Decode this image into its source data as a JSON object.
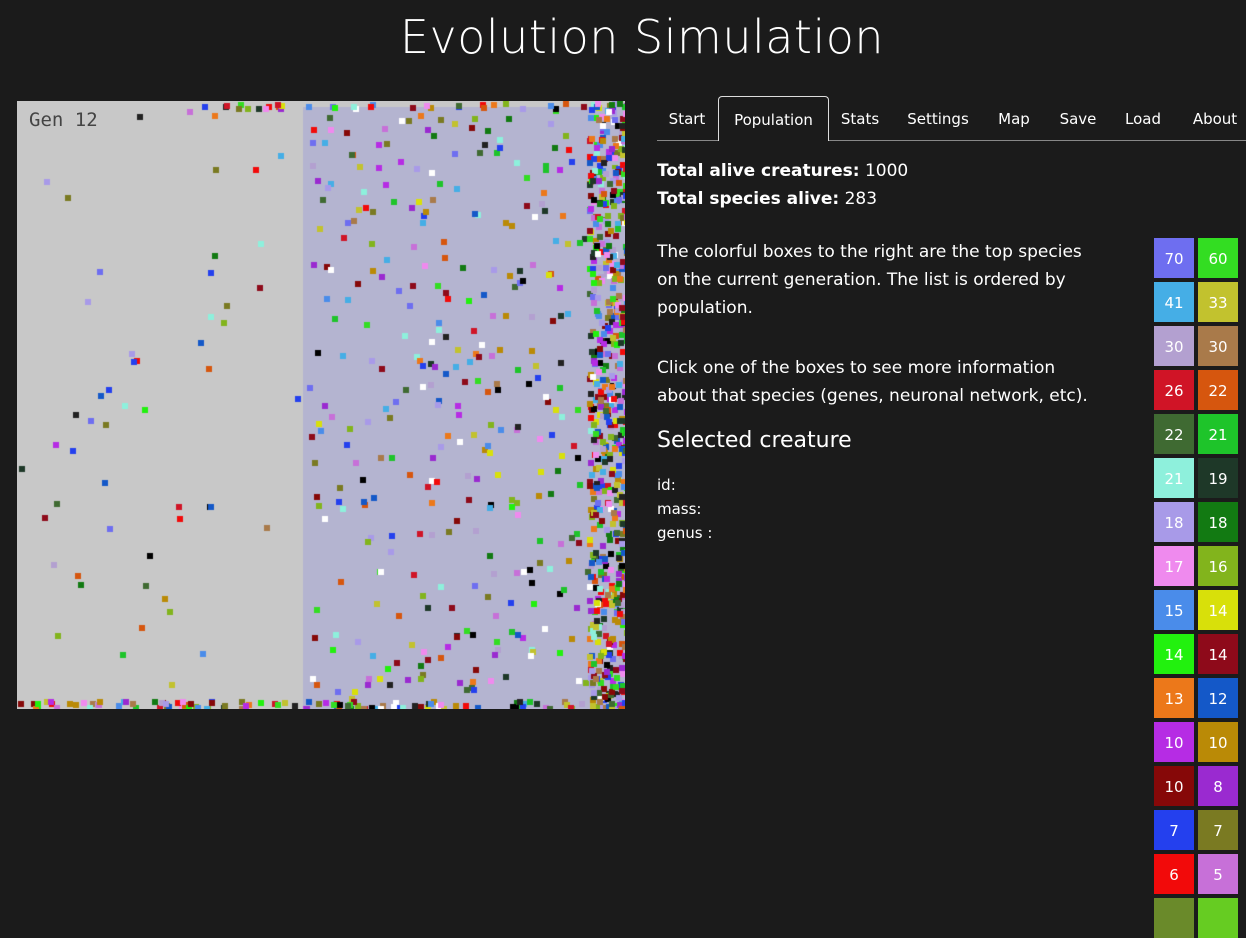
{
  "page": {
    "title": "Evolution Simulation"
  },
  "simulation": {
    "generation_label": "Gen 12"
  },
  "tabs": [
    {
      "label": "Start"
    },
    {
      "label": "Population",
      "active": true
    },
    {
      "label": "Stats"
    },
    {
      "label": "Settings"
    },
    {
      "label": "Map"
    },
    {
      "label": "Save"
    },
    {
      "label": "Load"
    },
    {
      "label": "About"
    }
  ],
  "population": {
    "alive_label": "Total alive creatures:",
    "alive_value": "1000",
    "species_label": "Total species alive:",
    "species_value": "283",
    "description_1": "The colorful boxes to the right are the top species on the current generation. The list is ordered by population.",
    "description_2": "Click one of the boxes to see more information about that species (genes, neuronal network, etc).",
    "selected_title": "Selected creature",
    "fields": [
      "id:",
      "mass:",
      "genus :"
    ]
  },
  "species": [
    {
      "count": 70,
      "color": "#6e6ef0"
    },
    {
      "count": 60,
      "color": "#33dd22"
    },
    {
      "count": 41,
      "color": "#45aee6"
    },
    {
      "count": 33,
      "color": "#c2c22e"
    },
    {
      "count": 30,
      "color": "#b3a0d0"
    },
    {
      "count": 30,
      "color": "#a97a4a"
    },
    {
      "count": 26,
      "color": "#d01426"
    },
    {
      "count": 22,
      "color": "#d6560e"
    },
    {
      "count": 22,
      "color": "#3f6a32"
    },
    {
      "count": 21,
      "color": "#1ec42a"
    },
    {
      "count": 21,
      "color": "#8ef0dc"
    },
    {
      "count": 19,
      "color": "#1e3828"
    },
    {
      "count": 18,
      "color": "#a89ae8"
    },
    {
      "count": 18,
      "color": "#127a12"
    },
    {
      "count": 17,
      "color": "#ef8aee"
    },
    {
      "count": 16,
      "color": "#82b41c"
    },
    {
      "count": 15,
      "color": "#4a8cea"
    },
    {
      "count": 14,
      "color": "#d8e00a"
    },
    {
      "count": 14,
      "color": "#22f10e"
    },
    {
      "count": 14,
      "color": "#8e0a1a"
    },
    {
      "count": 13,
      "color": "#ec781a"
    },
    {
      "count": 12,
      "color": "#1458c8"
    },
    {
      "count": 10,
      "color": "#b62ce4"
    },
    {
      "count": 10,
      "color": "#ba8a06"
    },
    {
      "count": 10,
      "color": "#860808"
    },
    {
      "count": 8,
      "color": "#9a2ad0"
    },
    {
      "count": 7,
      "color": "#2440ee"
    },
    {
      "count": 7,
      "color": "#7a7a22"
    },
    {
      "count": 6,
      "color": "#f20a0a"
    },
    {
      "count": 5,
      "color": "#c770d8"
    }
  ],
  "map": {
    "left_zone_color": "#c8c8c8",
    "right_zone_color": "#b4b4d0"
  }
}
